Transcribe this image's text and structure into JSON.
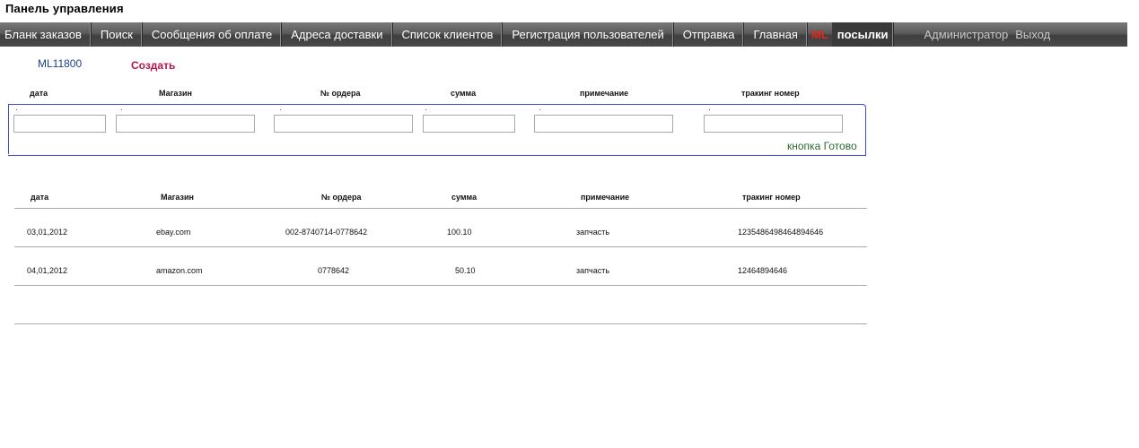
{
  "header": {
    "title": "Панель управления"
  },
  "nav": {
    "items": [
      "Бланк заказов",
      "Поиск",
      "Сообщения об оплате",
      "Адреса доставки",
      "Список клиентов",
      "Регистрация пользователей",
      "Отправка",
      "Главная"
    ],
    "logo_ml": "ML",
    "parcels": "посылки",
    "user": "Администратор",
    "logout": "Выход"
  },
  "order": {
    "id": "ML11800",
    "create_label": "Создать"
  },
  "form": {
    "headers": [
      "дата",
      "Магазин",
      "№ ордера",
      "сумма",
      "примечание",
      "тракинг номер"
    ],
    "values": [
      "",
      "",
      "",
      "",
      "",
      ""
    ],
    "done_label": "кнопка Готово"
  },
  "table": {
    "headers": [
      "дата",
      "Магазин",
      "№ ордера",
      "сумма",
      "примечание",
      "тракинг номер"
    ],
    "rows": [
      [
        "03,01,2012",
        "ebay.com",
        "002-8740714-0778642",
        "100.10",
        "запчасть",
        "1235486498464894646"
      ],
      [
        "04,01,2012",
        "amazon.com",
        "0778642",
        "50.10",
        "запчасть",
        "12464894646"
      ]
    ]
  },
  "colors": {
    "nav_bg": "#4a4a4a",
    "accent_red": "#e3281e",
    "link_blue": "#1b3f8f",
    "create_red": "#b5164a",
    "done_green": "#2c6a34",
    "form_border": "#3b4bd1"
  }
}
